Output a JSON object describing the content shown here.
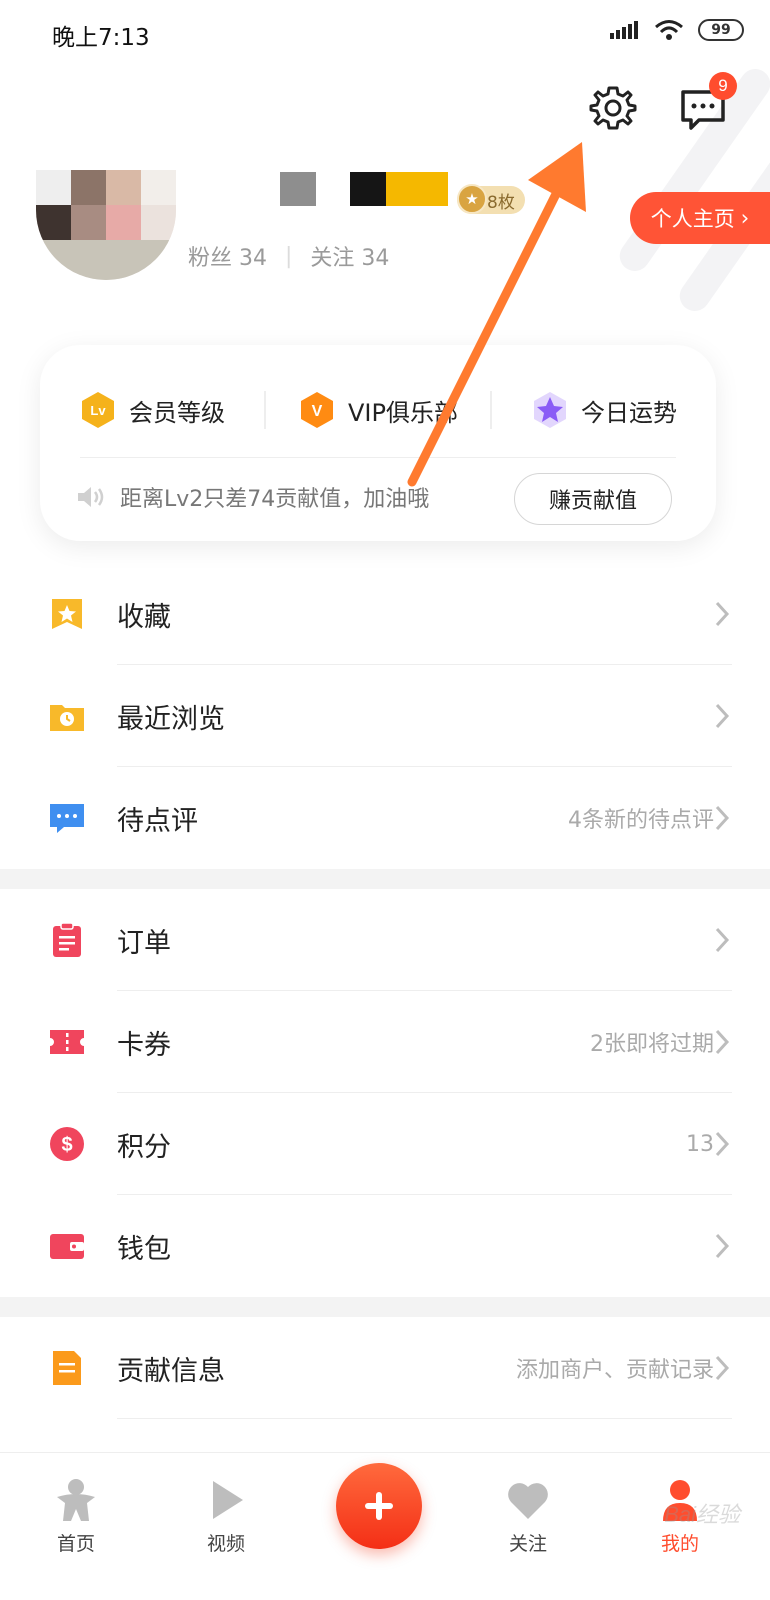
{
  "status_bar": {
    "time": "晚上7:13",
    "battery": "99"
  },
  "header": {
    "message_badge": "9"
  },
  "profile": {
    "medal_count": "8枚",
    "fans_label": "粉丝 34",
    "follow_label": "关注 34",
    "profile_button": "个人主页"
  },
  "membership": {
    "items": [
      {
        "label": "会员等级",
        "icon": "lv-hexagon-icon",
        "icon_text": "Lv",
        "color": "#f5b21b"
      },
      {
        "label": "VIP俱乐部",
        "icon": "v-hexagon-icon",
        "icon_text": "V",
        "color": "#ff8b12"
      },
      {
        "label": "今日运势",
        "icon": "star-hexagon-icon",
        "color": "#8a5cf6"
      }
    ],
    "tip": "距离Lv2只差74贡献值，加油哦",
    "earn_button": "赚贡献值"
  },
  "menu_section_1": [
    {
      "label": "收藏",
      "right": "",
      "icon": "bookmark-star-icon"
    },
    {
      "label": "最近浏览",
      "right": "",
      "icon": "folder-clock-icon"
    },
    {
      "label": "待点评",
      "right": "4条新的待点评",
      "icon": "comment-icon"
    }
  ],
  "menu_section_2": [
    {
      "label": "订单",
      "right": "",
      "icon": "clipboard-icon"
    },
    {
      "label": "卡券",
      "right": "2张即将过期",
      "icon": "ticket-icon"
    },
    {
      "label": "积分",
      "right": "13",
      "icon": "dollar-coin-icon"
    },
    {
      "label": "钱包",
      "right": "",
      "icon": "wallet-icon"
    }
  ],
  "menu_section_3": [
    {
      "label": "贡献信息",
      "right": "添加商户、贡献记录",
      "icon": "document-icon"
    }
  ],
  "tabbar": {
    "home": "首页",
    "video": "视频",
    "follow": "关注",
    "mine": "我的",
    "active_tab": "mine"
  },
  "watermark": "Bai经验",
  "colors": {
    "accent": "#ff4d2e",
    "arrow": "#ff7a2f"
  }
}
